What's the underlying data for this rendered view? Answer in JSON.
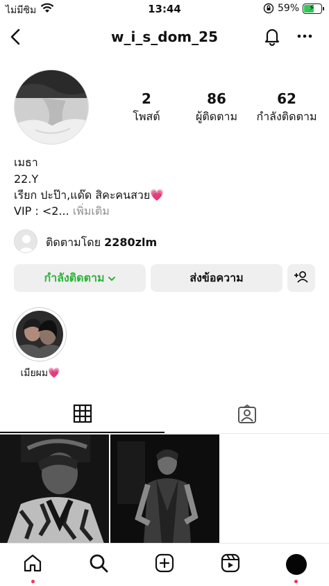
{
  "status_bar": {
    "carrier": "ไม่มีซิม",
    "time": "13:44",
    "battery_percent": "59%",
    "battery_level": 0.59
  },
  "header": {
    "username": "w_i_s_dom_25"
  },
  "profile": {
    "stats": [
      {
        "value": "2",
        "label": "โพสต์"
      },
      {
        "value": "86",
        "label": "ผู้ติดตาม"
      },
      {
        "value": "62",
        "label": "กำลังติดตาม"
      }
    ],
    "bio": {
      "name": "เมธา",
      "line2": "22.Y",
      "line3": "เรียก ปะป๊า,แด๊ด สิคะคนสวย💗",
      "line4": "VIP : <2...",
      "more": "เพิ่มเติม"
    },
    "followed_by_prefix": "ติดตามโดย",
    "followed_by_user": "2280zlm"
  },
  "actions": {
    "following_label": "กำลังติดตาม",
    "message_label": "ส่งข้อความ"
  },
  "highlights": [
    {
      "label": "เมียผม💗"
    }
  ],
  "colors": {
    "following_green": "#2bb33a",
    "notification_dot": "#ff2d55",
    "button_bg": "#efefef"
  },
  "icons": {
    "back": "chevron-left-icon",
    "bell": "bell-icon",
    "more": "more-horizontal-icon",
    "add_user": "add-user-icon",
    "grid": "grid-icon",
    "tagged": "tagged-icon",
    "home": "home-icon",
    "search": "search-icon",
    "create": "plus-square-icon",
    "reels": "reels-icon",
    "profile": "profile-avatar-icon"
  }
}
